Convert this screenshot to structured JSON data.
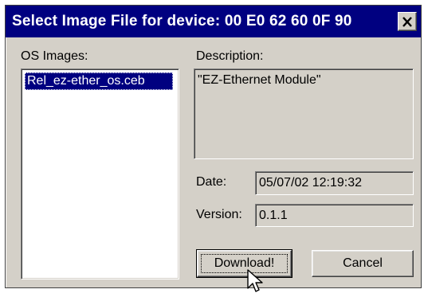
{
  "window": {
    "title": "Select Image File for device: 00 E0 62 60 0F 90"
  },
  "labels": {
    "os_images": "OS Images:",
    "description": "Description:",
    "date": "Date:",
    "version": "Version:"
  },
  "os_images": [
    "Rel_ez-ether_os.ceb"
  ],
  "description_text": "\"EZ-Ethernet Module\"",
  "date_value": "05/07/02 12:19:32",
  "version_value": "0.1.1",
  "buttons": {
    "download": "Download!",
    "cancel": "Cancel"
  },
  "icons": {
    "close": "close-icon",
    "cursor": "pointer-cursor-icon"
  },
  "colors": {
    "titlebar": "#000080",
    "face": "#d4d0c8",
    "selection": "#000080"
  }
}
